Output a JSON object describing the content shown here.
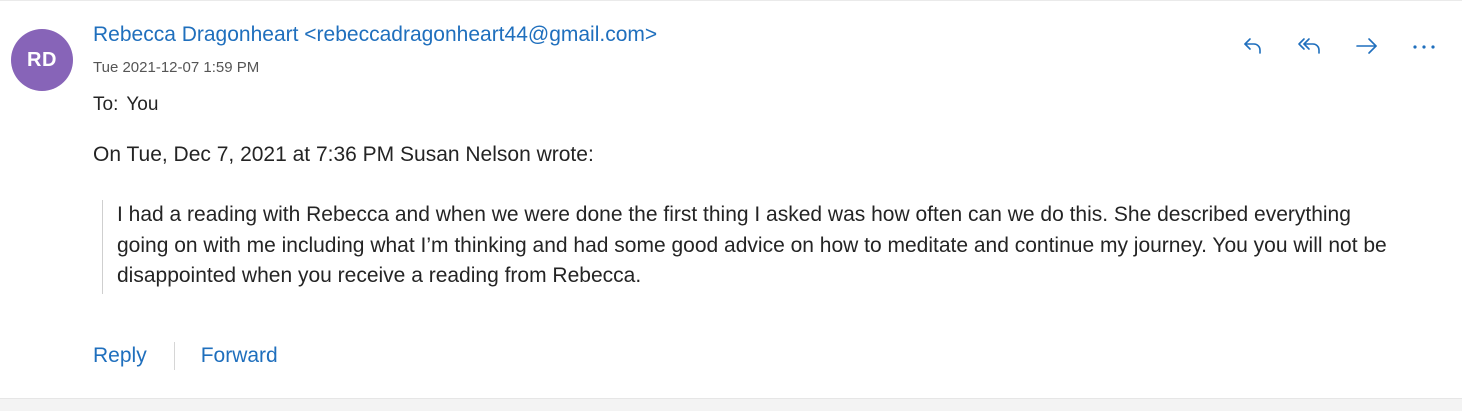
{
  "colors": {
    "accent": "#1f6fbd",
    "avatar_bg": "#8764b8",
    "text": "#242424",
    "muted": "#555555"
  },
  "message": {
    "avatar_initials": "RD",
    "sender": "Rebecca Dragonheart <rebeccadragonheart44@gmail.com>",
    "date": "Tue 2021-12-07 1:59 PM",
    "to_label": "To:",
    "to_value": "You",
    "intro": "On Tue, Dec 7, 2021 at 7:36 PM Susan Nelson wrote:",
    "quote": "I had a reading with Rebecca and when we were done the first thing I asked was how often can we do this. She described everything going on with me including what I’m thinking and had some good advice on how to meditate and continue my journey. You you will not be disappointed when you receive a reading from Rebecca."
  },
  "toolbar": {
    "icons": [
      "reply-icon",
      "reply-all-icon",
      "forward-icon",
      "more-icon"
    ]
  },
  "actions": {
    "reply_label": "Reply",
    "forward_label": "Forward"
  }
}
